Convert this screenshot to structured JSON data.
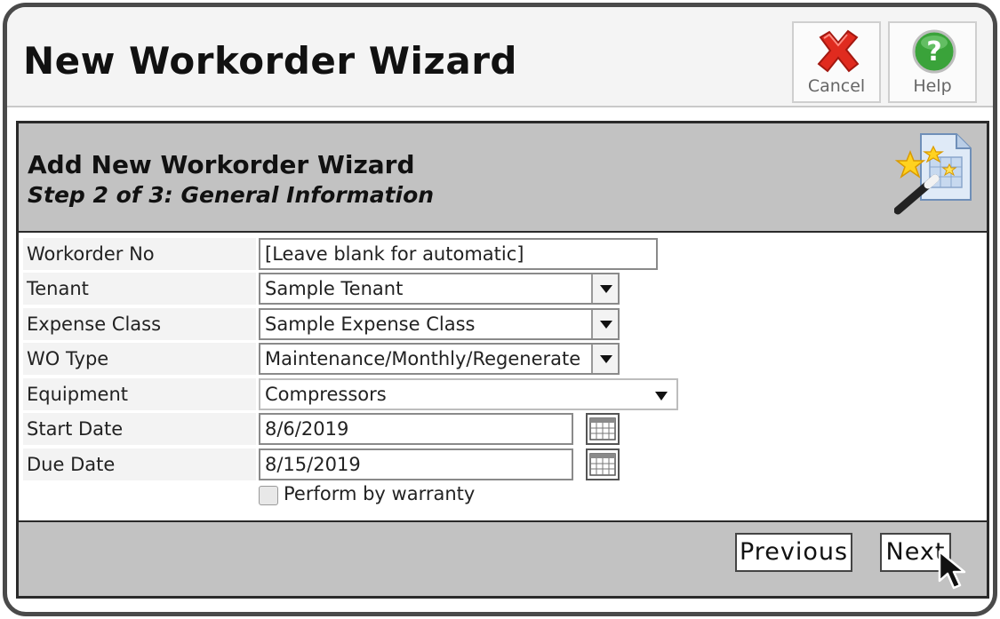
{
  "app": {
    "title": "New Workorder Wizard"
  },
  "toolbar": {
    "cancel_label": "Cancel",
    "help_label": "Help"
  },
  "wizard": {
    "title": "Add New Workorder Wizard",
    "step": "Step 2 of 3: General Information",
    "fields": {
      "workorder_no": {
        "label": "Workorder No",
        "placeholder": "[Leave blank for automatic]"
      },
      "tenant": {
        "label": "Tenant",
        "value": "Sample Tenant"
      },
      "expense_class": {
        "label": "Expense Class",
        "value": "Sample Expense Class"
      },
      "wo_type": {
        "label": "WO Type",
        "value": "Maintenance/Monthly/Regenerate"
      },
      "equipment": {
        "label": "Equipment",
        "value": "Compressors"
      },
      "start_date": {
        "label": "Start Date",
        "value": "8/6/2019"
      },
      "due_date": {
        "label": "Due Date",
        "value": "8/15/2019"
      }
    },
    "warranty": {
      "label": "Perform by warranty",
      "checked": false
    },
    "previous_label": "Previous",
    "next_label": "Next"
  },
  "colors": {
    "header_band": "#c2c2c2",
    "cancel_icon": "#e02b1f",
    "help_icon": "#3aa33a"
  },
  "icons": [
    "cancel-x-icon",
    "help-question-icon",
    "wizard-wand-icon",
    "calendar-icon",
    "mouse-cursor-icon"
  ]
}
